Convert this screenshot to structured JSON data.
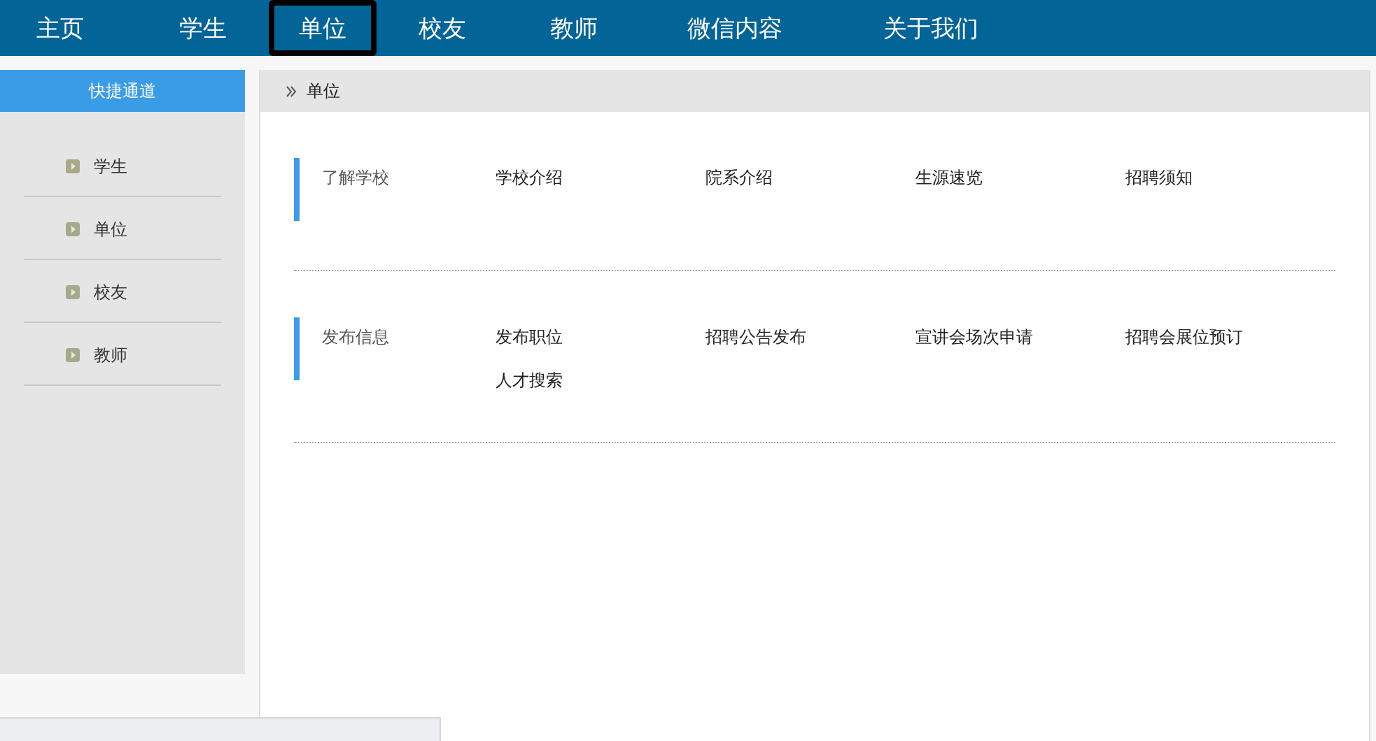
{
  "nav": [
    {
      "label": "主页",
      "selected": false
    },
    {
      "label": "学生",
      "selected": false
    },
    {
      "label": "单位",
      "selected": true
    },
    {
      "label": "校友",
      "selected": false
    },
    {
      "label": "教师",
      "selected": false
    },
    {
      "label": "微信内容",
      "selected": false
    },
    {
      "label": "关于我们",
      "selected": false
    }
  ],
  "sidebar": {
    "title": "快捷通道",
    "items": [
      {
        "label": "学生"
      },
      {
        "label": "单位"
      },
      {
        "label": "校友"
      },
      {
        "label": "教师"
      }
    ]
  },
  "breadcrumb": "单位",
  "sections": [
    {
      "label": "了解学校",
      "links": [
        "学校介绍",
        "院系介绍",
        "生源速览",
        "招聘须知"
      ]
    },
    {
      "label": "发布信息",
      "links": [
        "发布职位",
        "招聘公告发布",
        "宣讲会场次申请",
        "招聘会展位预订",
        "人才搜索"
      ]
    }
  ]
}
